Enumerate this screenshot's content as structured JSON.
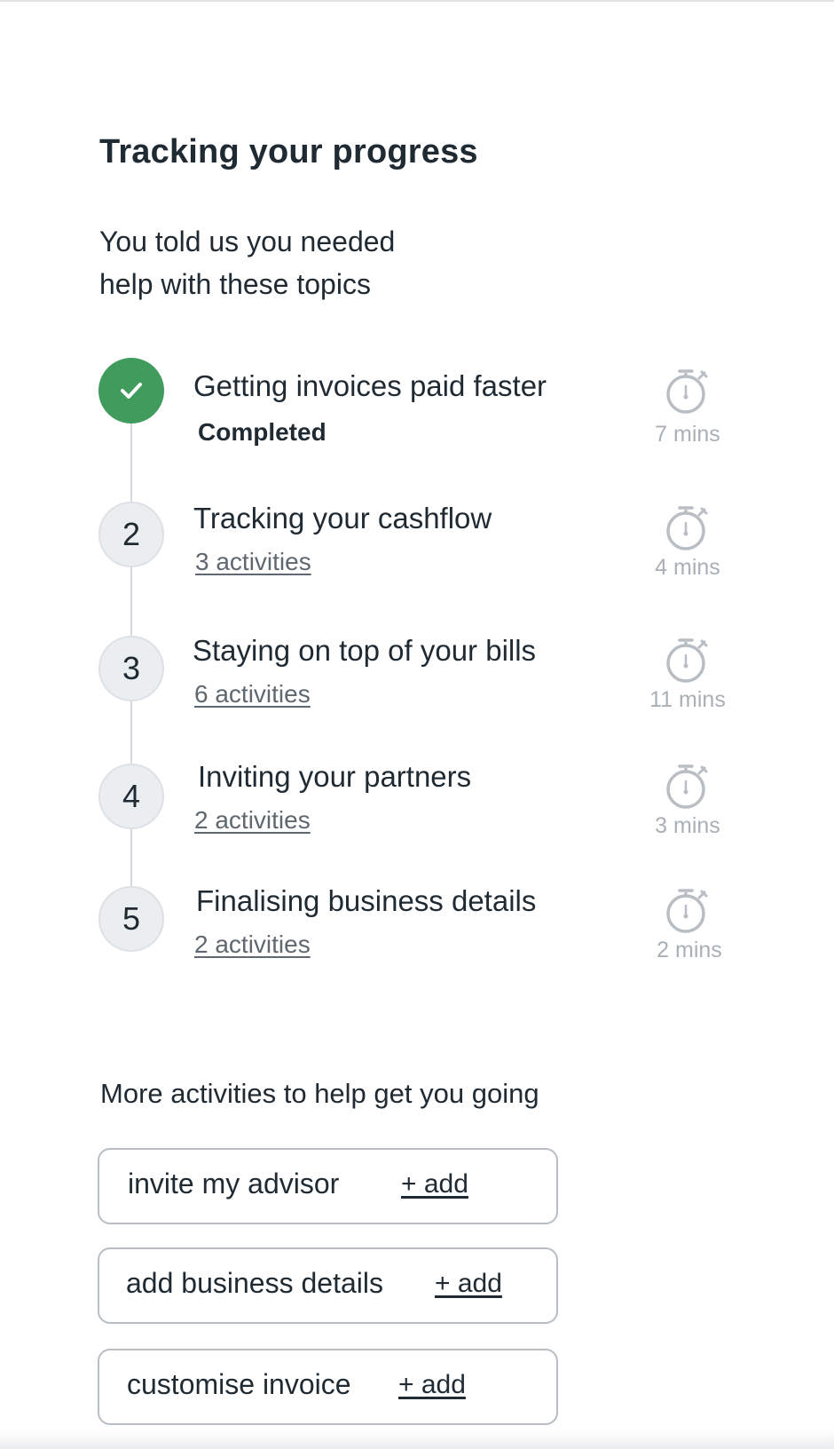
{
  "header": {
    "title": "Tracking your progress",
    "intro_line1": "You told us you needed",
    "intro_line2": "help with these topics"
  },
  "steps": [
    {
      "marker": "check-icon",
      "status": "completed",
      "title": "Getting invoices paid faster",
      "subtitle": "Completed",
      "duration": "7 mins",
      "timer_icon": "stopwatch-icon"
    },
    {
      "marker": "2",
      "status": "pending",
      "title": "Tracking your cashflow",
      "subtitle": "3 activities",
      "duration": "4 mins",
      "timer_icon": "stopwatch-icon"
    },
    {
      "marker": "3",
      "status": "pending",
      "title": "Staying on top of your bills",
      "subtitle": "6 activities",
      "duration": "11 mins",
      "timer_icon": "stopwatch-icon"
    },
    {
      "marker": "4",
      "status": "pending",
      "title": "Inviting your partners",
      "subtitle": "2 activities",
      "duration": "3 mins",
      "timer_icon": "stopwatch-icon"
    },
    {
      "marker": "5",
      "status": "pending",
      "title": "Finalising business details",
      "subtitle": "2 activities",
      "duration": "2 mins",
      "timer_icon": "stopwatch-icon"
    }
  ],
  "more_activities": {
    "heading": "More activities to help get you going",
    "items": [
      {
        "label": "invite my advisor",
        "action": "+ add"
      },
      {
        "label": "add business details",
        "action": "+ add"
      },
      {
        "label": "customise invoice",
        "action": "+ add"
      }
    ]
  },
  "colors": {
    "completed_green": "#3f9c5c",
    "text_dark": "#1f2a33",
    "muted_grey": "#a9b0b6",
    "marker_bg": "#ebeef1"
  }
}
